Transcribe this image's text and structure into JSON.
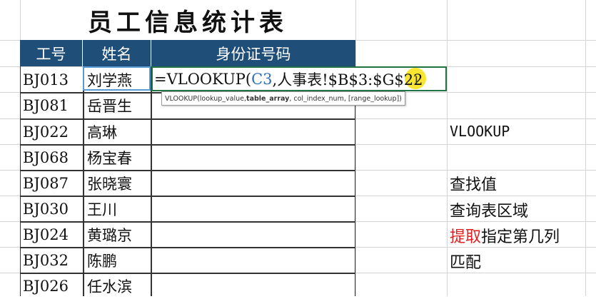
{
  "title": "员工信息统计表",
  "headers": [
    "工号",
    "姓名",
    "身份证号码"
  ],
  "rows": [
    {
      "id": "BJ013",
      "name": "刘学燕"
    },
    {
      "id": "BJ081",
      "name": "岳晋生"
    },
    {
      "id": "BJ022",
      "name": "高琳"
    },
    {
      "id": "BJ068",
      "name": "杨宝春"
    },
    {
      "id": "BJ087",
      "name": "张晓寰"
    },
    {
      "id": "BJ030",
      "name": "王川"
    },
    {
      "id": "BJ024",
      "name": "黄璐京"
    },
    {
      "id": "BJ032",
      "name": "陈鹏"
    },
    {
      "id": "BJ026",
      "name": "任水滨"
    }
  ],
  "formula": {
    "prefix": "=VLOOKUP(",
    "ref": "C3",
    "suffix": ",人事表!$B$3:$G$22"
  },
  "tooltip": {
    "fn": "VLOOKUP(",
    "arg1": "lookup_value, ",
    "arg2": "table_array",
    "rest": ", col_index_num, [range_lookup])"
  },
  "notes": {
    "fn": "VLOOKUP",
    "n1": "查找值",
    "n2": "查询表区域",
    "n3_red": "提取",
    "n3_rest": "指定第几列",
    "n4": "匹配"
  },
  "colors": {
    "header_bg": "#1f4e79",
    "formula_ref": "#2f6fba",
    "highlight": "#f7e21b",
    "red_text": "#e02020"
  }
}
